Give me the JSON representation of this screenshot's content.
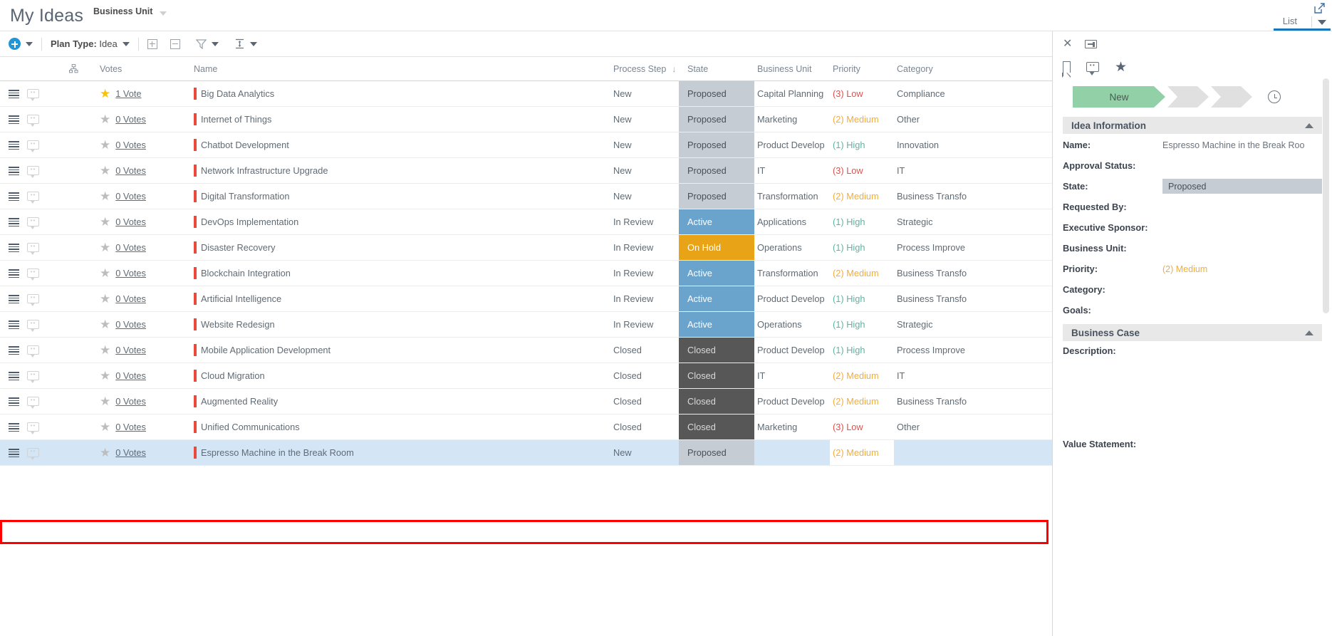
{
  "header": {
    "title": "My Ideas",
    "breadcrumb": "Business Unit",
    "view_tab": "List",
    "popout_icon": "popout-icon",
    "caret_icon": "chevron-down-icon"
  },
  "toolbar": {
    "add_label": "add-new",
    "plan_type_label": "Plan Type:",
    "plan_type_value": "Idea",
    "expand_all": "expand-all",
    "collapse_all": "collapse-all",
    "filter": "filter",
    "row_height": "row-height"
  },
  "grid": {
    "columns": [
      {
        "key": "tree",
        "label": ""
      },
      {
        "key": "votes",
        "label": "Votes"
      },
      {
        "key": "name",
        "label": "Name"
      },
      {
        "key": "step",
        "label": "Process Step",
        "sorted": "desc"
      },
      {
        "key": "state",
        "label": "State"
      },
      {
        "key": "bu",
        "label": "Business Unit"
      },
      {
        "key": "prio",
        "label": "Priority"
      },
      {
        "key": "cat",
        "label": "Category"
      }
    ],
    "rows": [
      {
        "votes": "1 Vote",
        "starred": true,
        "name": "Big Data Analytics",
        "step": "New",
        "state": "Proposed",
        "state_class": "st-proposed",
        "bu": "Capital Planning",
        "prio": "(3) Low",
        "prio_class": "prio-low",
        "cat": "Compliance"
      },
      {
        "votes": "0 Votes",
        "starred": false,
        "name": "Internet of Things",
        "step": "New",
        "state": "Proposed",
        "state_class": "st-proposed",
        "bu": "Marketing",
        "prio": "(2) Medium",
        "prio_class": "prio-med",
        "cat": "Other"
      },
      {
        "votes": "0 Votes",
        "starred": false,
        "name": "Chatbot Development",
        "step": "New",
        "state": "Proposed",
        "state_class": "st-proposed",
        "bu": "Product Develop",
        "prio": "(1) High",
        "prio_class": "prio-high",
        "cat": "Innovation"
      },
      {
        "votes": "0 Votes",
        "starred": false,
        "name": "Network Infrastructure Upgrade",
        "step": "New",
        "state": "Proposed",
        "state_class": "st-proposed",
        "bu": "IT",
        "prio": "(3) Low",
        "prio_class": "prio-low",
        "cat": "IT"
      },
      {
        "votes": "0 Votes",
        "starred": false,
        "name": "Digital Transformation",
        "step": "New",
        "state": "Proposed",
        "state_class": "st-proposed",
        "bu": "Transformation",
        "prio": "(2) Medium",
        "prio_class": "prio-med",
        "cat": "Business Transfo"
      },
      {
        "votes": "0 Votes",
        "starred": false,
        "name": "DevOps Implementation",
        "step": "In Review",
        "state": "Active",
        "state_class": "st-active",
        "bu": "Applications",
        "prio": "(1) High",
        "prio_class": "prio-high",
        "cat": "Strategic"
      },
      {
        "votes": "0 Votes",
        "starred": false,
        "name": "Disaster Recovery",
        "step": "In Review",
        "state": "On Hold",
        "state_class": "st-onhold",
        "bu": "Operations",
        "prio": "(1) High",
        "prio_class": "prio-high",
        "cat": "Process Improve"
      },
      {
        "votes": "0 Votes",
        "starred": false,
        "name": "Blockchain Integration",
        "step": "In Review",
        "state": "Active",
        "state_class": "st-active",
        "bu": "Transformation",
        "prio": "(2) Medium",
        "prio_class": "prio-med",
        "cat": "Business Transfo"
      },
      {
        "votes": "0 Votes",
        "starred": false,
        "name": "Artificial Intelligence",
        "step": "In Review",
        "state": "Active",
        "state_class": "st-active",
        "bu": "Product Develop",
        "prio": "(1) High",
        "prio_class": "prio-high",
        "cat": "Business Transfo"
      },
      {
        "votes": "0 Votes",
        "starred": false,
        "name": "Website Redesign",
        "step": "In Review",
        "state": "Active",
        "state_class": "st-active",
        "bu": "Operations",
        "prio": "(1) High",
        "prio_class": "prio-high",
        "cat": "Strategic"
      },
      {
        "votes": "0 Votes",
        "starred": false,
        "name": "Mobile Application Development",
        "step": "Closed",
        "state": "Closed",
        "state_class": "st-closed",
        "bu": "Product Develop",
        "prio": "(1) High",
        "prio_class": "prio-high",
        "cat": "Process Improve"
      },
      {
        "votes": "0 Votes",
        "starred": false,
        "name": "Cloud Migration",
        "step": "Closed",
        "state": "Closed",
        "state_class": "st-closed",
        "bu": "IT",
        "prio": "(2) Medium",
        "prio_class": "prio-med",
        "cat": "IT"
      },
      {
        "votes": "0 Votes",
        "starred": false,
        "name": "Augmented Reality",
        "step": "Closed",
        "state": "Closed",
        "state_class": "st-closed",
        "bu": "Product Develop",
        "prio": "(2) Medium",
        "prio_class": "prio-med",
        "cat": "Business Transfo"
      },
      {
        "votes": "0 Votes",
        "starred": false,
        "name": "Unified Communications",
        "step": "Closed",
        "state": "Closed",
        "state_class": "st-closed",
        "bu": "Marketing",
        "prio": "(3) Low",
        "prio_class": "prio-low",
        "cat": "Other"
      },
      {
        "votes": "0 Votes",
        "starred": false,
        "name": "Espresso Machine in the Break Room",
        "step": "New",
        "state": "Proposed",
        "state_class": "st-proposed",
        "bu": "",
        "prio": "(2) Medium",
        "prio_class": "prio-med",
        "cat": "",
        "selected": true
      }
    ]
  },
  "detail": {
    "close_icon": "close-icon",
    "dock_icon": "dock-panel-icon",
    "bookmark_icon": "bookmark-icon",
    "comment_icon": "comment-icon",
    "favorite_icon": "star-icon",
    "history_icon": "history-icon",
    "stage_current": "New",
    "sections": [
      {
        "title": "Idea Information",
        "fields": [
          {
            "label": "Name:",
            "value": "Espresso Machine in the Break Roo",
            "style": "plain"
          },
          {
            "label": "Approval Status:",
            "value": "",
            "style": "plain"
          },
          {
            "label": "State:",
            "value": "Proposed",
            "style": "boxed"
          },
          {
            "label": "Requested By:",
            "value": "",
            "style": "plain"
          },
          {
            "label": "Executive Sponsor:",
            "value": "",
            "style": "plain"
          },
          {
            "label": "Business Unit:",
            "value": "",
            "style": "plain"
          },
          {
            "label": "Priority:",
            "value": "(2) Medium",
            "style": "prio-med"
          },
          {
            "label": "Category:",
            "value": "",
            "style": "plain"
          },
          {
            "label": "Goals:",
            "value": "",
            "style": "plain"
          }
        ]
      },
      {
        "title": "Business Case",
        "blocks": [
          {
            "label": "Description:"
          },
          {
            "label": "Value Statement:"
          }
        ]
      }
    ]
  },
  "colors": {
    "accent": "#1b75bb",
    "add_button": "#2196d6",
    "state_proposed": "#c6ccd4",
    "state_active": "#6aa4cd",
    "state_onhold": "#e8a317",
    "state_closed": "#575757",
    "priority_low": "#d9534f",
    "priority_medium": "#f0ad3e",
    "priority_high": "#5cb4a0",
    "selection_row": "#d4e6f5",
    "highlight_outline": "#ff0000",
    "stage_active": "#92d1a8",
    "name_bar": "#ea4a3b"
  }
}
